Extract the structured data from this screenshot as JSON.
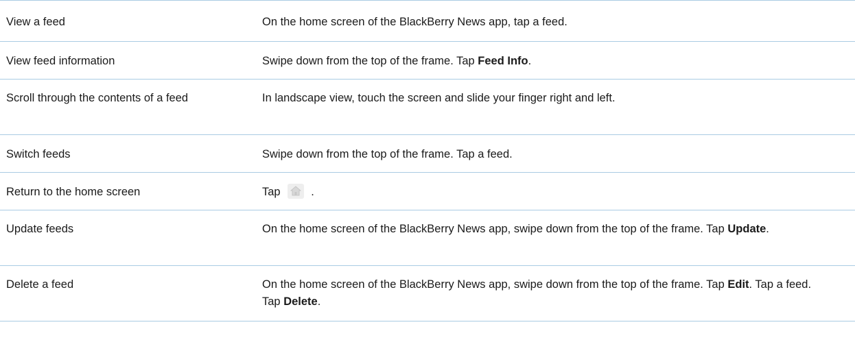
{
  "rows": [
    {
      "task": "View a feed",
      "action": [
        "On the home screen of the BlackBerry News app, tap a feed."
      ]
    },
    {
      "task": "View feed information",
      "action": [
        "Swipe down from the top of the frame. Tap ",
        "Feed Info",
        "."
      ]
    },
    {
      "task": "Scroll through the contents of a feed",
      "action": [
        "In landscape view, touch the screen and slide your finger right and left."
      ]
    },
    {
      "task": "Switch feeds",
      "action": [
        "Swipe down from the top of the frame. Tap a feed."
      ]
    },
    {
      "task": "Return to the home screen",
      "action": [
        "Tap",
        " ."
      ],
      "icon": "home-icon"
    },
    {
      "task": "Update feeds",
      "action": [
        "On the home screen of the BlackBerry News app, swipe down from the top of the frame. Tap ",
        "Update",
        "."
      ]
    },
    {
      "task": "Delete a feed",
      "action": [
        "On the home screen of the BlackBerry News app, swipe down from the top of the frame. Tap ",
        "Edit",
        ". Tap a feed. Tap ",
        "Delete",
        "."
      ]
    }
  ]
}
